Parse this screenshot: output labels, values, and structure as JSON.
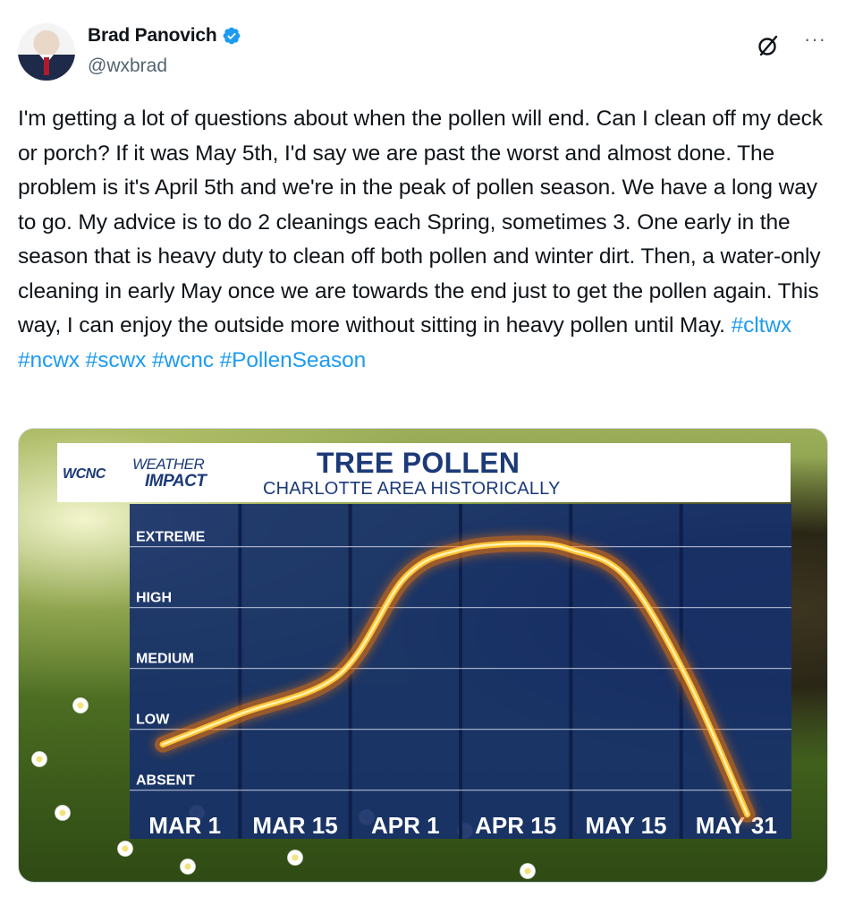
{
  "author": {
    "display_name": "Brad Panovich",
    "handle": "@wxbrad",
    "verified": true
  },
  "icons": {
    "verified": "verified-badge-icon",
    "grok": "grok-icon",
    "more": "more-options-icon"
  },
  "more_glyph": "···",
  "tweet": {
    "body": "I'm getting a lot of questions about when the pollen will end. Can I clean off my deck or porch? If it was May 5th, I'd say we are past the worst and almost done. The problem is it's April 5th and we're in the peak of pollen season. We have a long way to go. My advice is to do 2 cleanings each Spring, sometimes 3. One early in the season that is heavy duty to clean off both pollen and winter dirt. Then, a water-only cleaning in early May once we are towards the end just to get the pollen again. This way, I can enjoy the outside more without sitting in heavy pollen until May.",
    "hashtags": [
      "#cltwx",
      "#ncwx",
      "#scwx",
      "#wcnc",
      "#PollenSeason"
    ]
  },
  "media": {
    "logo": {
      "station": "WCNC",
      "line1": "WEATHER",
      "line2": "IMPACT"
    }
  },
  "colors": {
    "hashtag": "#1d9bf0",
    "chart_panel": "#17306b",
    "chart_title": "#1c3a78",
    "curve": "#ffb21e"
  },
  "chart_data": {
    "type": "line",
    "title": "TREE POLLEN",
    "subtitle": "CHARLOTTE AREA HISTORICALLY",
    "categories": [
      "MAR 1",
      "MAR 15",
      "APR 1",
      "APR 15",
      "MAY 15",
      "MAY 31"
    ],
    "y_levels": [
      "ABSENT",
      "LOW",
      "MEDIUM",
      "HIGH",
      "EXTREME"
    ],
    "series": [
      {
        "x": [
          0.3,
          1.0,
          1.9,
          2.5,
          3.0,
          3.6,
          4.0,
          4.5,
          5.05,
          5.6
        ],
        "values": [
          1.25,
          1.75,
          2.4,
          4.0,
          4.45,
          4.55,
          4.45,
          4.0,
          2.35,
          0.1
        ]
      }
    ],
    "xlim": [
      0,
      6
    ],
    "ylim": [
      -0.3,
      5.2
    ],
    "grid": true
  }
}
